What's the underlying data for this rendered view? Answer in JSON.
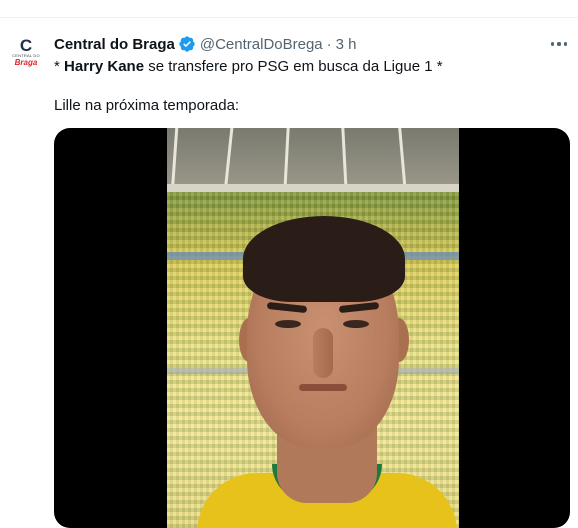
{
  "tweet": {
    "display_name": "Central do Braga",
    "handle": "@CentralDoBrega",
    "separator": "·",
    "time": "3 h",
    "avatar": {
      "letter": "C",
      "small_text": "CENTRAL DO",
      "brand_text": "Braga"
    },
    "text_line1": {
      "prefix": "* ",
      "bold": "Harry Kane",
      "rest": " se transfere pro PSG em busca da Ligue 1 *"
    },
    "text_line2": "Lille na próxima temporada:",
    "verified_icon": "verified-badge-icon",
    "more_icon": "more-options-icon",
    "colors": {
      "verified": "#1d9bf0",
      "secondary_text": "#536471",
      "primary_text": "#0f1419",
      "media_background": "#000000"
    }
  }
}
